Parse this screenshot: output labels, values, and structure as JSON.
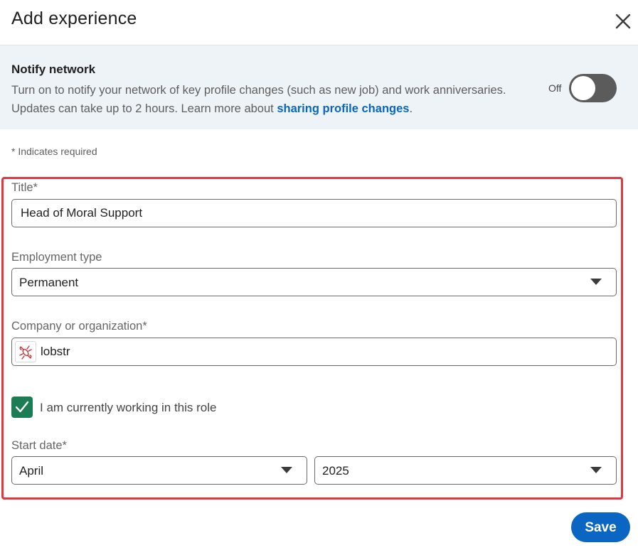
{
  "dialog": {
    "title": "Add experience",
    "close_icon": "close-icon"
  },
  "notify": {
    "title": "Notify network",
    "description_line1": "Turn on to notify your network of key profile changes (such as new job) and work anniversaries.",
    "description_line2": "Updates can take up to 2 hours. Learn more about ",
    "link_text": "sharing profile changes",
    "description_end": ".",
    "toggle_label": "Off",
    "toggle_on": false
  },
  "form": {
    "required_note": "* Indicates required",
    "title_label": "Title*",
    "title_value": "Head of Moral Support",
    "employment_label": "Employment type",
    "employment_value": "Permanent",
    "company_label": "Company or organization*",
    "company_value": "lobstr",
    "company_logo_icon": "lobster-logo-icon",
    "current_role_label": "I am currently working in this role",
    "current_role_checked": true,
    "start_date_label": "Start date*",
    "start_month": "April",
    "start_year": "2025"
  },
  "footer": {
    "save_label": "Save"
  },
  "colors": {
    "accent": "#0a66c2",
    "checkbox": "#1c7d55",
    "highlight": "#e0383e",
    "notify_bg": "#eef3f8",
    "toggle_off": "#5b5b5b"
  }
}
